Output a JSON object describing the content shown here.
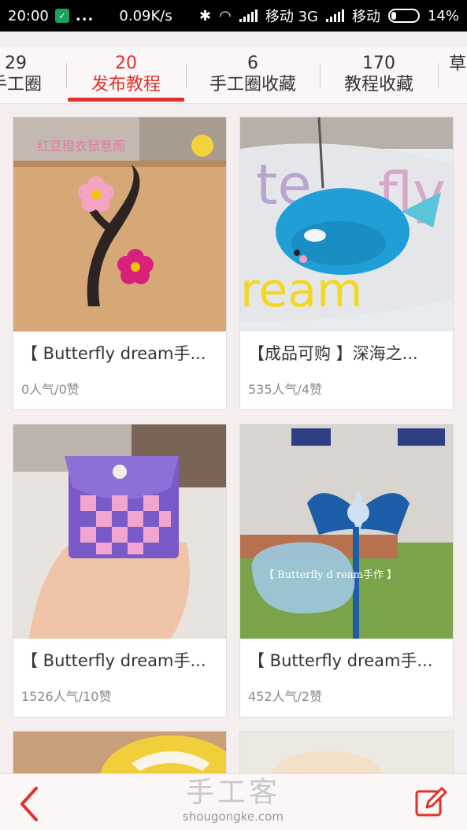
{
  "status_bar": {
    "time": "20:00",
    "dots": "...",
    "speed": "0.09K/s",
    "carrier1": "移动 3G",
    "carrier2": "移动",
    "battery": "14%"
  },
  "tabs": [
    {
      "count": "29",
      "label": "手工圈",
      "active": false
    },
    {
      "count": "20",
      "label": "发布教程",
      "active": true
    },
    {
      "count": "6",
      "label": "手工圈收藏",
      "active": false
    },
    {
      "count": "170",
      "label": "教程收藏",
      "active": false
    },
    {
      "count": "",
      "label": "草",
      "active": false
    }
  ],
  "cards": [
    {
      "title": "【 Butterfly dream手...",
      "meta": "0人气/0赞",
      "image": "felt-branch-flowers-photo"
    },
    {
      "title": "【成品可购 】深海之...",
      "meta": "535人气/4赞",
      "image": "felt-whale-keychain-photo"
    },
    {
      "title": "【 Butterfly dream手...",
      "meta": "1526人气/10赞",
      "image": "felt-woven-pouch-photo"
    },
    {
      "title": "【 Butterfly dream手...",
      "meta": "452人气/2赞",
      "image": "felt-bow-hairclip-photo"
    }
  ],
  "overlays": {
    "card1_caption": "红豆橙衣鼠意阁",
    "card4_caption": "【 Butterfly d ream手作 】"
  },
  "bottom_bar": {
    "brand_name": "手工客",
    "brand_url": "shougongke.com",
    "back_icon": "chevron-left-icon",
    "edit_icon": "edit-square-icon"
  },
  "colors": {
    "accent": "#e0322b",
    "background": "#f4eeee"
  }
}
